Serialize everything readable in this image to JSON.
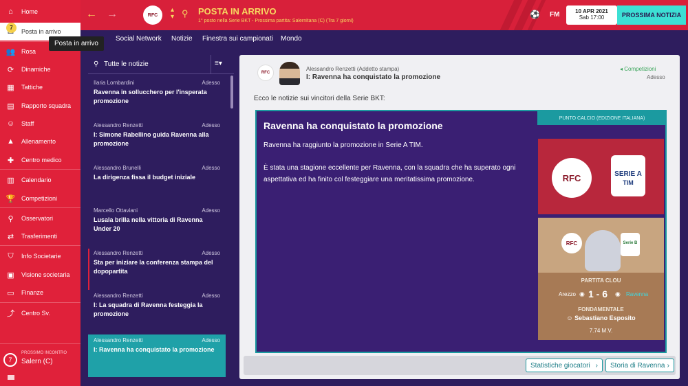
{
  "sidebar": {
    "items": [
      {
        "label": "Home",
        "icon": "home-icon"
      },
      {
        "label": "Posta in arrivo",
        "icon": "inbox-icon",
        "badge": "7"
      },
      {
        "label": "Rosa",
        "icon": "squad-icon"
      },
      {
        "label": "Dinamiche",
        "icon": "dynamics-icon"
      },
      {
        "label": "Tattiche",
        "icon": "tactics-icon"
      },
      {
        "label": "Rapporto squadra",
        "icon": "report-icon"
      },
      {
        "label": "Staff",
        "icon": "staff-icon"
      },
      {
        "label": "Allenamento",
        "icon": "training-icon"
      },
      {
        "label": "Centro medico",
        "icon": "medical-icon"
      },
      {
        "label": "Calendario",
        "icon": "calendar-icon"
      },
      {
        "label": "Competizioni",
        "icon": "trophy-icon"
      },
      {
        "label": "Osservatori",
        "icon": "scouting-icon"
      },
      {
        "label": "Trasferimenti",
        "icon": "transfer-icon"
      },
      {
        "label": "Info Societarie",
        "icon": "club-info-icon"
      },
      {
        "label": "Visione societaria",
        "icon": "vision-icon"
      },
      {
        "label": "Finanze",
        "icon": "finance-icon"
      },
      {
        "label": "Centro Sv.",
        "icon": "development-icon"
      }
    ],
    "tooltip": "Posta in arrivo",
    "next_match": {
      "label": "PROSSIMO INCONTRO",
      "opponent": "Salern (C)",
      "number": "7"
    }
  },
  "header": {
    "title": "POSTA IN ARRIVO",
    "subtitle": "1° posto nella Serie BKT - Prossima partita: Salernitana (C) (Tra 7 giorni)",
    "club_badge": "RFC",
    "fm_label": "FM",
    "date": "10 APR 2021",
    "time": "Sab 17:00",
    "continue_label": "PROSSIMA NOTIZIA"
  },
  "subnav": {
    "tabs": [
      "Social Network",
      "Notizie",
      "Finestra sui campionati",
      "Mondo"
    ]
  },
  "newslist": {
    "filter": "Tutte le notizie",
    "items": [
      {
        "sender": "Ilaria Lombardini",
        "time": "Adesso",
        "title": "Ravenna in sollucchero per l'insperata promozione"
      },
      {
        "sender": "Alessandro Renzetti",
        "time": "Adesso",
        "title": "I: Simone Rabellino guida Ravenna alla promozione"
      },
      {
        "sender": "Alessandro Brunelli",
        "time": "Adesso",
        "title": "La dirigenza fissa il budget iniziale"
      },
      {
        "sender": "Marcello Ottaviani",
        "time": "Adesso",
        "title": "Lusala brilla nella vittoria di Ravenna Under 20"
      },
      {
        "sender": "Alessandro Renzetti",
        "time": "Adesso",
        "title": "Sta per iniziare la conferenza stampa del dopopartita"
      },
      {
        "sender": "Alessandro Renzetti",
        "time": "Adesso",
        "title": "I: La squadra di Ravenna festeggia la promozione"
      },
      {
        "sender": "Alessandro Renzetti",
        "time": "Adesso",
        "title": "I: Ravenna ha conquistato la promozione"
      }
    ]
  },
  "message": {
    "sender": "Alessandro Renzetti (Addetto stampa)",
    "subject": "I: Ravenna ha conquistato la promozione",
    "tag": "Competizioni",
    "time": "Adesso",
    "club_badge": "RFC",
    "intro": "Ecco le notizie sui vincitori della Serie BKT:",
    "source": "PUNTO CALCIO (EDIZIONE ITALIANA)",
    "headline": "Ravenna ha conquistato la promozione",
    "para1": "Ravenna ha raggiunto la promozione in Serie A TIM.",
    "para2": "È stata una stagione eccellente per Ravenna, con la squadra che ha superato ogni aspettativa ed ha finito col festeggiare una meritatissima promozione.",
    "seriea_line1": "SERIE A",
    "seriea_line2": "TIM",
    "serieb_badge": "Serie B",
    "key_match": "PARTITA CLOU",
    "home_team": "Arezzo",
    "score": "1 - 6",
    "away_team": "Ravenna",
    "key_player_label": "FONDAMENTALE",
    "key_player": "Sebastiano Esposito",
    "rating": "7.74 M.V.",
    "btn_stats": "Statistiche giocatori",
    "btn_history": "Storia di  Ravenna"
  }
}
